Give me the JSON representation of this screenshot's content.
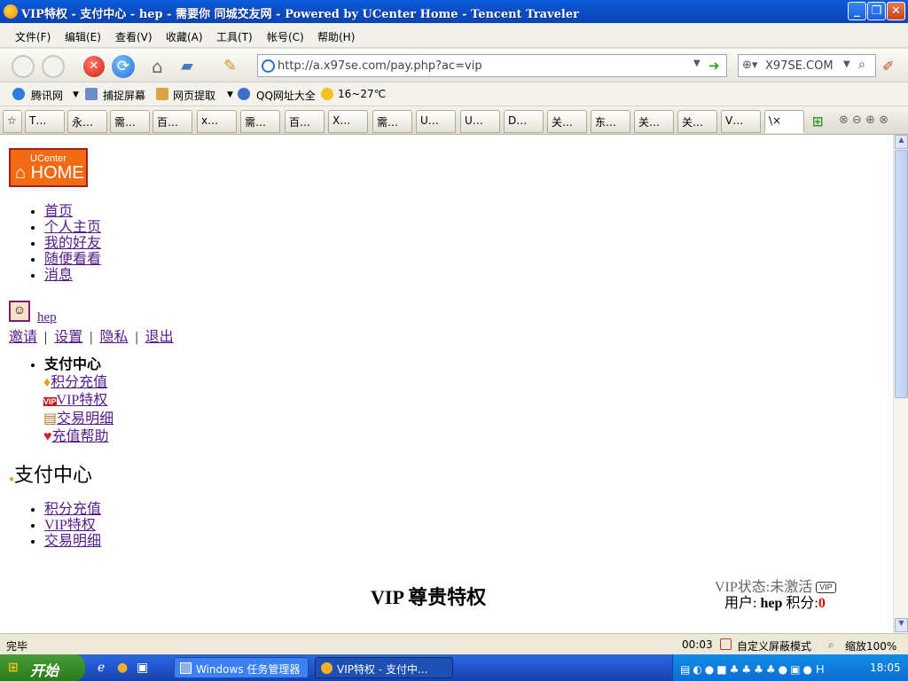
{
  "window": {
    "title": "VIP特权 - 支付中心 - hep - 需要你 同城交友网 - Powered by UCenter Home - Tencent Traveler"
  },
  "menu": [
    "文件(F)",
    "编辑(E)",
    "查看(V)",
    "收藏(A)",
    "工具(T)",
    "帐号(C)",
    "帮助(H)"
  ],
  "address": {
    "url": "http://a.x97se.com/pay.php?ac=vip"
  },
  "search": {
    "value": "X97SE.COM"
  },
  "links": [
    "腾讯网",
    "捕捉屏幕",
    "网页提取",
    "QQ网址大全",
    "16~27℃"
  ],
  "tabs": [
    "T…",
    "永…",
    "需…",
    "百…",
    "x…",
    "需…",
    "百…",
    "X…",
    "需…",
    "U…",
    "U…",
    "D…",
    "关…",
    "东…",
    "关…",
    "关…",
    "V…",
    "\\×"
  ],
  "page": {
    "logo_top": "UCenter",
    "logo_main": "HOME",
    "nav": [
      "首页",
      "个人主页",
      "我的好友",
      "随便看看",
      "消息"
    ],
    "user": "hep",
    "user_links": [
      "邀请",
      "设置",
      "隐私",
      "退出"
    ],
    "pay_menu_title": "支付中心",
    "pay_menu": [
      "积分充值",
      "VIP特权",
      "交易明细",
      "充值帮助"
    ],
    "section_title": "支付中心",
    "sub_links": [
      "积分充值",
      "VIP特权",
      "交易明细"
    ],
    "vip_heading": "VIP 尊贵特权",
    "vip_status": "VIP状态:未激活",
    "vip_badge": "VIP",
    "user_label": "用户:",
    "user_name": "hep",
    "points_label": "积分:",
    "points_value": "0"
  },
  "status": {
    "text": "完毕",
    "time": "00:03",
    "mode": "自定义屏蔽模式",
    "zoom": "缩放100%"
  },
  "taskbar": {
    "start": "开始",
    "tasks": [
      "Windows 任务管理器",
      "VIP特权 - 支付中..."
    ],
    "clock": "18:05"
  }
}
